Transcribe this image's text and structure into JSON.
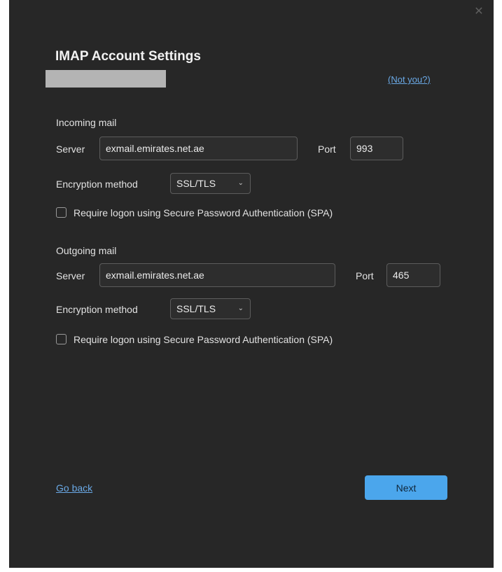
{
  "dialog": {
    "title": "IMAP Account Settings",
    "close_icon": "close-icon",
    "not_you_label": "(Not you?)"
  },
  "incoming": {
    "section_label": "Incoming mail",
    "server_label": "Server",
    "server_value": "exmail.emirates.net.ae",
    "port_label": "Port",
    "port_value": "993",
    "encryption_label": "Encryption method",
    "encryption_value": "SSL/TLS",
    "spa_label": "Require logon using Secure Password Authentication (SPA)",
    "spa_checked": false
  },
  "outgoing": {
    "section_label": "Outgoing mail",
    "server_label": "Server",
    "server_value": "exmail.emirates.net.ae",
    "port_label": "Port",
    "port_value": "465",
    "encryption_label": "Encryption method",
    "encryption_value": "SSL/TLS",
    "spa_label": "Require logon using Secure Password Authentication (SPA)",
    "spa_checked": false
  },
  "footer": {
    "go_back_label": "Go back",
    "next_label": "Next"
  },
  "colors": {
    "background": "#272727",
    "accent": "#4ba6ec",
    "link": "#6aa9e6"
  }
}
